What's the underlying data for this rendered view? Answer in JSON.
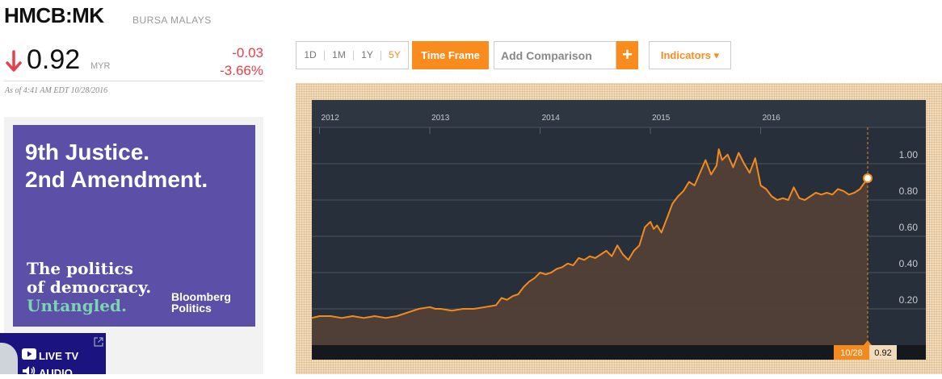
{
  "quote": {
    "ticker": "HMCB:MK",
    "exchange": "BURSA MALAYS",
    "price": "0.92",
    "currency": "MYR",
    "change": "-0.03",
    "change_pct": "-3.66%",
    "as_of": "As of 4:41 AM EDT 10/28/2016",
    "direction_icon": "arrow-down-icon",
    "down_color": "#e5414b"
  },
  "ad": {
    "headline_1": "9th Justice.",
    "headline_2": "2nd Amendment.",
    "sub_1": "The politics",
    "sub_2": "of democracy.",
    "sub_3": "Untangled.",
    "brand_1": "Bloomberg",
    "brand_2": "Politics"
  },
  "live": {
    "live_label": "LIVE TV",
    "audio_label": "AUDIO"
  },
  "toolbar": {
    "ranges": [
      "1D",
      "1M",
      "1Y",
      "5Y"
    ],
    "active_range": "5Y",
    "timeframe_label": "Time Frame",
    "compare_placeholder": "Add Comparison",
    "add_label": "+",
    "indicators_label": "Indicators ▾",
    "accent_color": "#fa8c1e"
  },
  "chart_data": {
    "type": "area",
    "x_tick_labels": [
      "2012",
      "2013",
      "2014",
      "2015",
      "2016"
    ],
    "y_ticks": [
      0.2,
      0.4,
      0.6,
      0.8,
      1.0
    ],
    "y_tick_labels": [
      "0.20",
      "0.40",
      "0.60",
      "0.80",
      "1.00"
    ],
    "ylim": [
      0.0,
      1.2
    ],
    "xlim": [
      2011.93,
      2016.97
    ],
    "grid": true,
    "line_color": "#f28a1e",
    "last_point_label": "10/28",
    "last_value_label": "0.92",
    "series": [
      {
        "x": [
          2011.93,
          2012.0,
          2012.1,
          2012.2,
          2012.3,
          2012.4,
          2012.5,
          2012.6,
          2012.7,
          2012.8,
          2012.9,
          2013.0,
          2013.05,
          2013.1,
          2013.2,
          2013.3,
          2013.4,
          2013.5,
          2013.6,
          2013.65,
          2013.7,
          2013.75,
          2013.8,
          2013.85,
          2013.9,
          2013.95,
          2014.0,
          2014.05,
          2014.1,
          2014.15,
          2014.2,
          2014.25,
          2014.3,
          2014.35,
          2014.4,
          2014.45,
          2014.5,
          2014.55,
          2014.6,
          2014.65,
          2014.7,
          2014.75,
          2014.8,
          2014.85,
          2014.9,
          2014.95,
          2015.0,
          2015.03,
          2015.06,
          2015.1,
          2015.15,
          2015.2,
          2015.25,
          2015.3,
          2015.35,
          2015.4,
          2015.45,
          2015.5,
          2015.55,
          2015.6,
          2015.62,
          2015.65,
          2015.7,
          2015.75,
          2015.8,
          2015.85,
          2015.9,
          2015.95,
          2016.0,
          2016.05,
          2016.1,
          2016.15,
          2016.2,
          2016.25,
          2016.3,
          2016.35,
          2016.4,
          2016.45,
          2016.5,
          2016.55,
          2016.6,
          2016.65,
          2016.7,
          2016.75,
          2016.8,
          2016.85,
          2016.9,
          2016.97
        ],
        "y": [
          0.15,
          0.16,
          0.16,
          0.15,
          0.16,
          0.15,
          0.16,
          0.15,
          0.16,
          0.18,
          0.2,
          0.21,
          0.2,
          0.2,
          0.19,
          0.2,
          0.2,
          0.21,
          0.22,
          0.26,
          0.25,
          0.27,
          0.28,
          0.32,
          0.35,
          0.37,
          0.4,
          0.39,
          0.4,
          0.42,
          0.43,
          0.45,
          0.44,
          0.48,
          0.47,
          0.49,
          0.48,
          0.5,
          0.52,
          0.49,
          0.55,
          0.5,
          0.47,
          0.52,
          0.55,
          0.65,
          0.68,
          0.64,
          0.66,
          0.62,
          0.7,
          0.78,
          0.82,
          0.85,
          0.9,
          0.88,
          0.95,
          1.02,
          0.94,
          0.99,
          1.08,
          1.02,
          1.05,
          0.98,
          1.06,
          1.0,
          0.95,
          1.03,
          0.88,
          0.86,
          0.82,
          0.8,
          0.81,
          0.8,
          0.87,
          0.81,
          0.8,
          0.82,
          0.84,
          0.83,
          0.84,
          0.83,
          0.86,
          0.85,
          0.83,
          0.84,
          0.86,
          0.92
        ]
      }
    ]
  }
}
